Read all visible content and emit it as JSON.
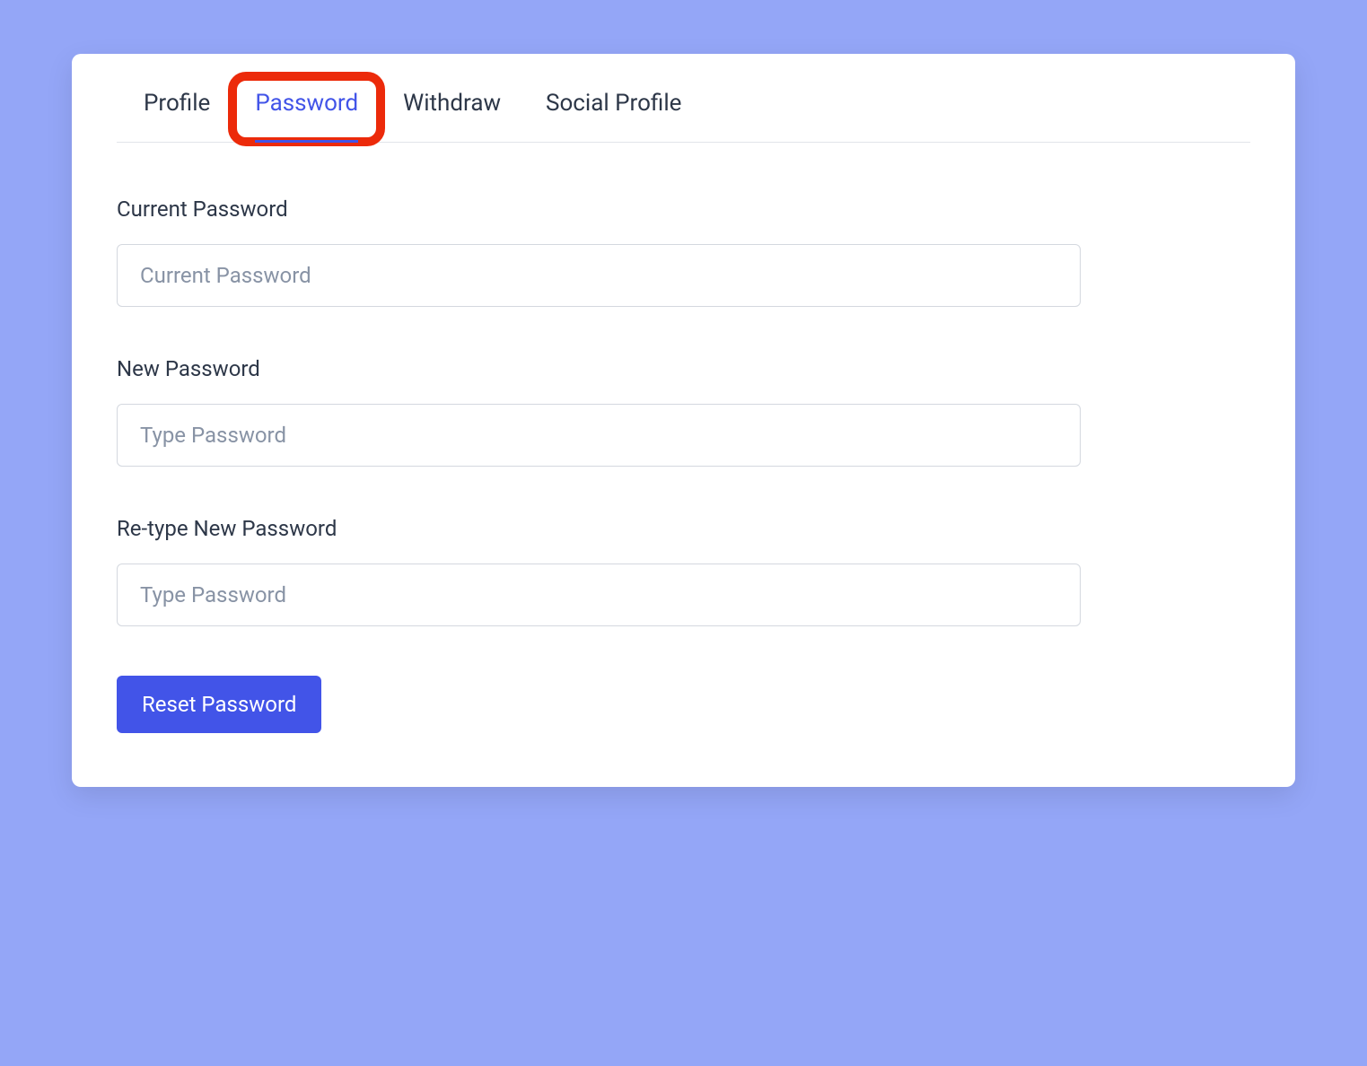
{
  "tabs": {
    "profile": {
      "label": "Profile"
    },
    "password": {
      "label": "Password"
    },
    "withdraw": {
      "label": "Withdraw"
    },
    "social": {
      "label": "Social Profile"
    }
  },
  "form": {
    "current_password": {
      "label": "Current Password",
      "placeholder": "Current Password"
    },
    "new_password": {
      "label": "New Password",
      "placeholder": "Type Password"
    },
    "retype_password": {
      "label": "Re-type New Password",
      "placeholder": "Type Password"
    },
    "submit_label": "Reset Password"
  }
}
